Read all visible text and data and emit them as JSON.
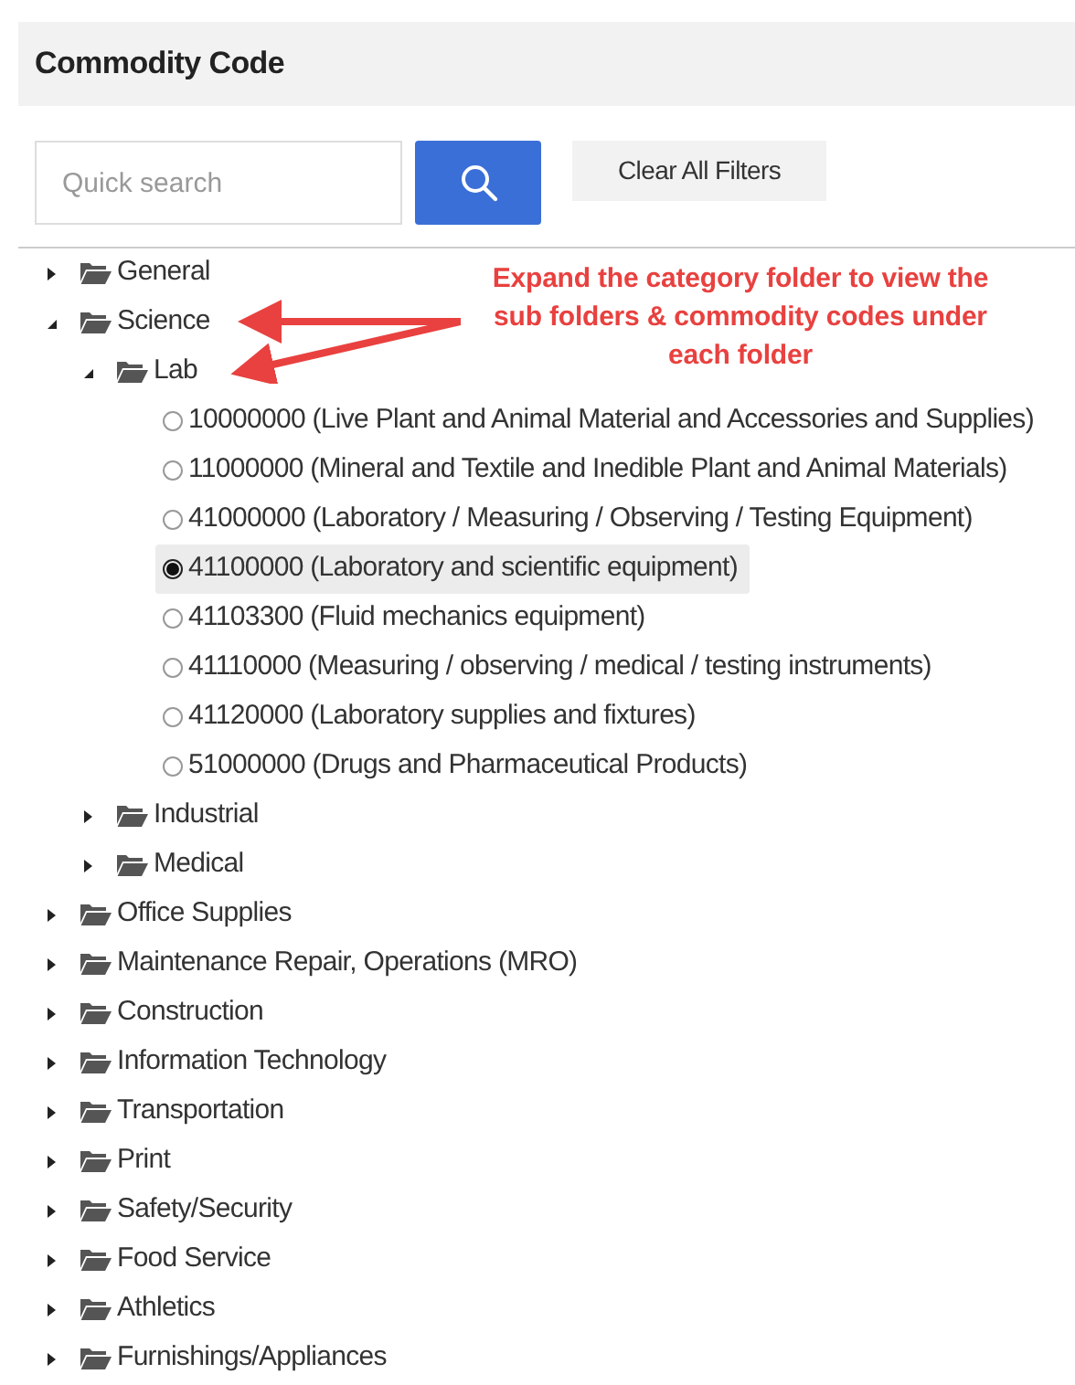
{
  "header": {
    "title": "Commodity Code"
  },
  "search": {
    "placeholder": "Quick search"
  },
  "clear_button": {
    "label": "Clear All Filters"
  },
  "annotation": {
    "text": "Expand the category folder to view the sub folders & commodity codes under each folder"
  },
  "tree": [
    {
      "kind": "folder",
      "label": "General",
      "expanded": false
    },
    {
      "kind": "folder",
      "label": "Science",
      "expanded": true,
      "children": [
        {
          "kind": "folder",
          "label": "Lab",
          "expanded": true,
          "children": [
            {
              "kind": "code",
              "label": "10000000 (Live Plant and Animal Material and Accessories and Supplies)",
              "selected": false
            },
            {
              "kind": "code",
              "label": "11000000 (Mineral and Textile and Inedible Plant and Animal Materials)",
              "selected": false
            },
            {
              "kind": "code",
              "label": "41000000 (Laboratory / Measuring / Observing / Testing Equipment)",
              "selected": false
            },
            {
              "kind": "code",
              "label": "41100000 (Laboratory and scientific equipment)",
              "selected": true
            },
            {
              "kind": "code",
              "label": "41103300 (Fluid mechanics equipment)",
              "selected": false
            },
            {
              "kind": "code",
              "label": "41110000 (Measuring / observing / medical / testing instruments)",
              "selected": false
            },
            {
              "kind": "code",
              "label": "41120000 (Laboratory supplies and fixtures)",
              "selected": false
            },
            {
              "kind": "code",
              "label": "51000000 (Drugs and Pharmaceutical Products)",
              "selected": false
            }
          ]
        },
        {
          "kind": "folder",
          "label": "Industrial",
          "expanded": false
        },
        {
          "kind": "folder",
          "label": "Medical",
          "expanded": false
        }
      ]
    },
    {
      "kind": "folder",
      "label": "Office Supplies",
      "expanded": false
    },
    {
      "kind": "folder",
      "label": "Maintenance Repair, Operations (MRO)",
      "expanded": false
    },
    {
      "kind": "folder",
      "label": "Construction",
      "expanded": false
    },
    {
      "kind": "folder",
      "label": "Information Technology",
      "expanded": false
    },
    {
      "kind": "folder",
      "label": "Transportation",
      "expanded": false
    },
    {
      "kind": "folder",
      "label": "Print",
      "expanded": false
    },
    {
      "kind": "folder",
      "label": "Safety/Security",
      "expanded": false
    },
    {
      "kind": "folder",
      "label": "Food Service",
      "expanded": false
    },
    {
      "kind": "folder",
      "label": "Athletics",
      "expanded": false
    },
    {
      "kind": "folder",
      "label": "Furnishings/Appliances",
      "expanded": false
    }
  ]
}
